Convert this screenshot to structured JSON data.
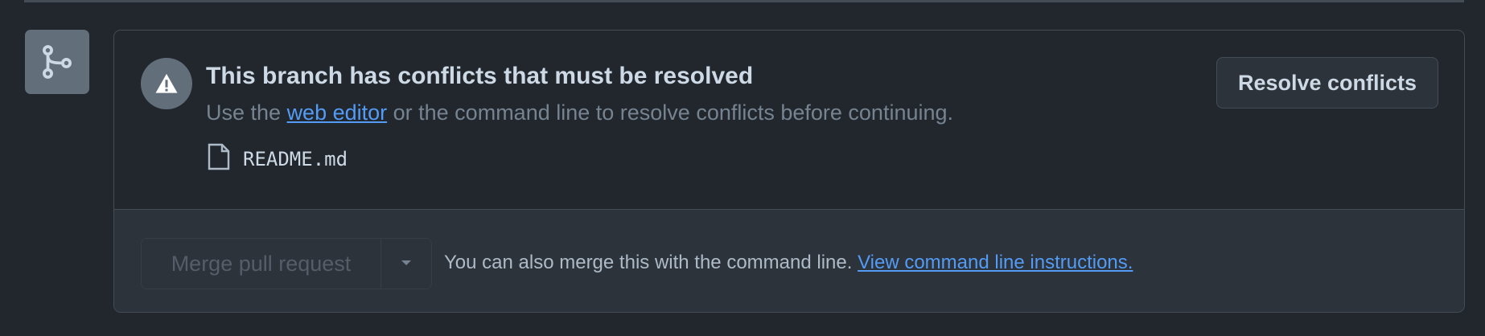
{
  "merge_box": {
    "icon": "git-branch-icon",
    "conflict": {
      "icon": "alert-triangle-icon",
      "title": "This branch has conflicts that must be resolved",
      "subtitle_prefix": "Use the ",
      "web_editor_link": "web editor",
      "subtitle_suffix": " or the command line to resolve conflicts before continuing.",
      "files": [
        {
          "icon": "file-icon",
          "name": "README.md"
        }
      ],
      "resolve_button": "Resolve conflicts"
    },
    "merge": {
      "button_label": "Merge pull request",
      "dropdown_icon": "triangle-down-icon",
      "note_prefix": "You can also merge this with the command line. ",
      "instructions_link": "View command line instructions."
    }
  },
  "colors": {
    "background": "#22272e",
    "accent_link": "#539bf5",
    "border": "#444c56",
    "icon_badge": "#636e7b"
  }
}
